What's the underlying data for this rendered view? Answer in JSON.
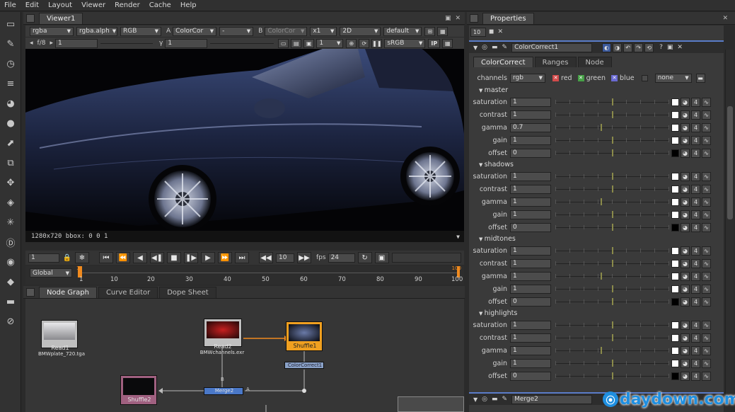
{
  "menubar": {
    "items": [
      "File",
      "Edit",
      "Layout",
      "Viewer",
      "Render",
      "Cache",
      "Help"
    ]
  },
  "viewer": {
    "tab": "Viewer1",
    "row1": {
      "channels": "rgba",
      "alpha": "rgba.alph",
      "display": "RGB",
      "a_label": "A",
      "a_input": "ColorCor",
      "a_op": "-",
      "b_label": "B",
      "b_input": "ColorCor",
      "zoom": "x1",
      "view": "2D",
      "lut": "default"
    },
    "row2": {
      "fstop": "f/8",
      "gain_value": "1",
      "gamma_label": "γ",
      "gamma_value": "1",
      "frame": "1",
      "colorspace": "sRGB",
      "ip_label": "IP"
    },
    "info": "1280x720 bbox: 0 0 1"
  },
  "transport": {
    "current_frame": "1",
    "step": "10",
    "fps_label": "fps",
    "fps_value": "24"
  },
  "timeline": {
    "range_mode": "Global",
    "ticks": [
      "1",
      "10",
      "20",
      "30",
      "40",
      "50",
      "60",
      "70",
      "80",
      "90",
      "100"
    ],
    "start": "1",
    "end": "100"
  },
  "nodegraph": {
    "tabs": [
      "Node Graph",
      "Curve Editor",
      "Dope Sheet"
    ],
    "nodes": [
      {
        "name": "Read1",
        "sub": "BMWplate_720.tga"
      },
      {
        "name": "Read2",
        "sub": "BMWchannels.exr"
      },
      {
        "name": "Shuffle1",
        "sub": ""
      },
      {
        "name": "ColorCorrect1",
        "sub": ""
      },
      {
        "name": "Shuffle2",
        "sub": ""
      },
      {
        "name": "Merge2",
        "sub": ""
      }
    ],
    "pipe_labels": {
      "b": "B",
      "a": "A"
    }
  },
  "properties": {
    "tab": "Properties",
    "max_panels": "10",
    "node_name": "ColorCorrect1",
    "subtabs": [
      "ColorCorrect",
      "Ranges",
      "Node"
    ],
    "channels_label": "channels",
    "channels_value": "rgb",
    "channel_flags": [
      "red",
      "green",
      "blue"
    ],
    "channel_extra": "none",
    "sections": [
      {
        "title": "master",
        "params": [
          {
            "label": "saturation",
            "value": "1"
          },
          {
            "label": "contrast",
            "value": "1"
          },
          {
            "label": "gamma",
            "value": "0.7"
          },
          {
            "label": "gain",
            "value": "1"
          },
          {
            "label": "offset",
            "value": "0"
          }
        ]
      },
      {
        "title": "shadows",
        "params": [
          {
            "label": "saturation",
            "value": "1"
          },
          {
            "label": "contrast",
            "value": "1"
          },
          {
            "label": "gamma",
            "value": "1"
          },
          {
            "label": "gain",
            "value": "1"
          },
          {
            "label": "offset",
            "value": "0"
          }
        ]
      },
      {
        "title": "midtones",
        "params": [
          {
            "label": "saturation",
            "value": "1"
          },
          {
            "label": "contrast",
            "value": "1"
          },
          {
            "label": "gamma",
            "value": "1"
          },
          {
            "label": "gain",
            "value": "1"
          },
          {
            "label": "offset",
            "value": "0"
          }
        ]
      },
      {
        "title": "highlights",
        "params": [
          {
            "label": "saturation",
            "value": "1"
          },
          {
            "label": "contrast",
            "value": "1"
          },
          {
            "label": "gamma",
            "value": "1"
          },
          {
            "label": "gain",
            "value": "1"
          },
          {
            "label": "offset",
            "value": "0"
          }
        ]
      }
    ],
    "animation_index": "4",
    "second_node": "Merge2"
  },
  "watermark": "daydown.com",
  "colors": {
    "accent": "#f08a1e",
    "shuffle_node": "#f0a020",
    "cc_node": "#8aa2c8",
    "merge_node": "#4a78c8",
    "read_node": "#bfbfbf",
    "red_flag": "#d24b4b",
    "green_flag": "#46a046",
    "blue_flag": "#6a6ad2",
    "watermark": "#1f8fe0"
  }
}
